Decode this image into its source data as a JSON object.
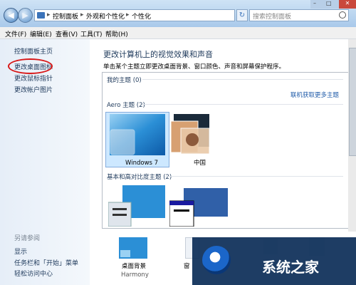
{
  "window": {
    "breadcrumb": [
      "控制面板",
      "外观和个性化",
      "个性化"
    ],
    "breadcrumb_sep": "▸",
    "search_placeholder": "搜索控制面板",
    "caption_buttons": [
      "–",
      "□",
      "✕"
    ]
  },
  "menu": [
    "文件(F)",
    "编辑(E)",
    "查看(V)",
    "工具(T)",
    "帮助(H)"
  ],
  "sidebar": {
    "links": [
      "控制面板主页",
      "更改桌面图标",
      "更改鼠标指针",
      "更改帐户图片"
    ],
    "see_also_title": "另请参阅",
    "see_also": [
      "显示",
      "任务栏和「开始」菜单",
      "轻松访问中心"
    ]
  },
  "main": {
    "title": "更改计算机上的视觉效果和声音",
    "subtitle": "单击某个主题立即更改桌面背景、窗口颜色、声音和屏幕保护程序。",
    "my_themes": "我的主题 (0)",
    "online_link": "联机获取更多主题",
    "aero_themes": "Aero 主题 (2)",
    "basic_themes": "基本和高对比度主题 (2)",
    "themes": [
      {
        "name": "Windows 7",
        "selected": true
      },
      {
        "name": "中国",
        "selected": false
      }
    ],
    "bottom": [
      {
        "label": "桌面背景",
        "sub": "Harmony"
      },
      {
        "label": "窗"
      }
    ]
  },
  "watermark": {
    "text": "系统之家"
  }
}
